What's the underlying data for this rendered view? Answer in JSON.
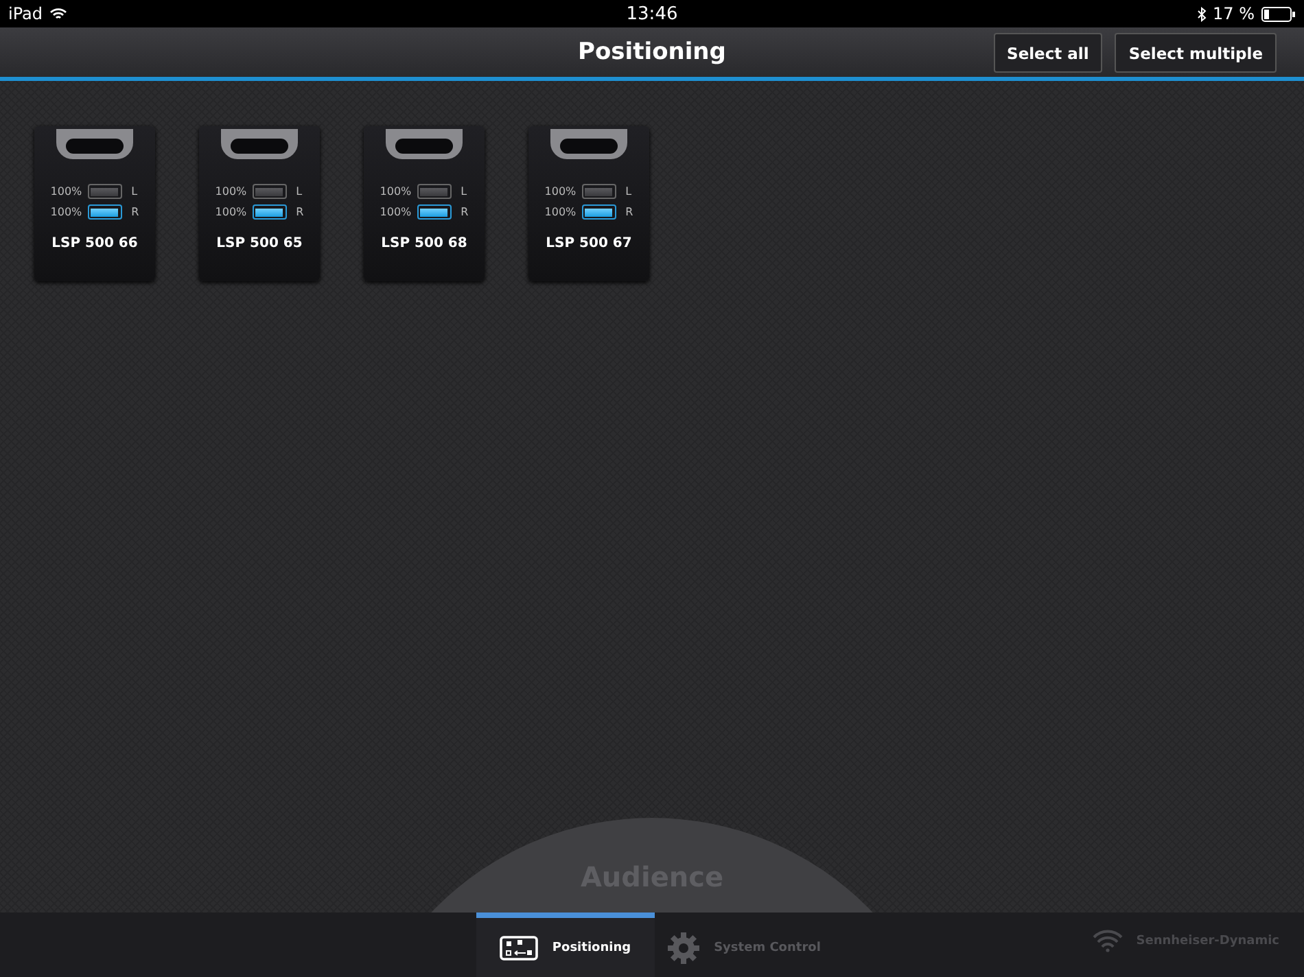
{
  "status_bar": {
    "device": "iPad",
    "time": "13:46",
    "battery": "17 %"
  },
  "header": {
    "title": "Positioning",
    "buttons": [
      "Select all",
      "Select multiple"
    ]
  },
  "speakers": [
    {
      "name": "LSP 500 66",
      "batteries": [
        {
          "reading": "100%",
          "level": 1,
          "active": false,
          "side": "L"
        },
        {
          "reading": "100%",
          "level": 1,
          "active": true,
          "side": "R"
        }
      ]
    },
    {
      "name": "LSP 500 65",
      "batteries": [
        {
          "reading": "100%",
          "level": 1,
          "active": false,
          "side": "L"
        },
        {
          "reading": "100%",
          "level": 1,
          "active": true,
          "side": "R"
        }
      ]
    },
    {
      "name": "LSP 500 68",
      "batteries": [
        {
          "reading": "100%",
          "level": 1,
          "active": false,
          "side": "L"
        },
        {
          "reading": "100%",
          "level": 1,
          "active": true,
          "side": "R"
        }
      ]
    },
    {
      "name": "LSP 500 67",
      "batteries": [
        {
          "reading": "100%",
          "level": 1,
          "active": false,
          "side": "L"
        },
        {
          "reading": "100%",
          "level": 1,
          "active": true,
          "side": "R"
        }
      ]
    }
  ],
  "audience": {
    "label": "Audience"
  },
  "tab_bar": {
    "tabs": [
      {
        "label": "Positioning",
        "kind": "positioning",
        "selected": true
      },
      {
        "label": "System Control",
        "kind": "system",
        "selected": false
      }
    ],
    "network": "Sennheiser-Dynamic"
  }
}
